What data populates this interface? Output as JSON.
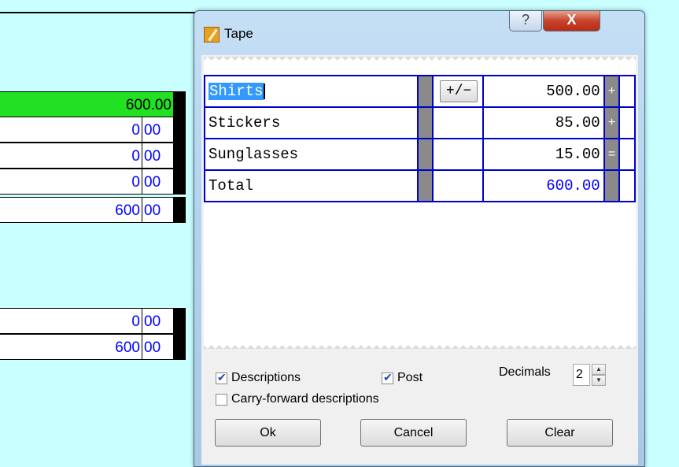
{
  "sheet": {
    "rows": [
      {
        "value": "600.00",
        "highlight": true
      },
      {
        "whole": "0",
        "frac": "00"
      },
      {
        "whole": "0",
        "frac": "00"
      },
      {
        "whole": "0",
        "frac": "00"
      },
      {
        "whole": "600",
        "frac": "00"
      },
      {
        "whole": "0",
        "frac": "00"
      },
      {
        "whole": "600",
        "frac": "00"
      }
    ]
  },
  "dialog": {
    "title": "Tape",
    "help_label": "?",
    "close_label": "X",
    "tape": {
      "rows": [
        {
          "desc": "Shirts",
          "pm": "+/−",
          "amount": "500.00",
          "op": "+"
        },
        {
          "desc": "Stickers",
          "pm": "",
          "amount": "85.00",
          "op": "+"
        },
        {
          "desc": "Sunglasses",
          "pm": "",
          "amount": "15.00",
          "op": "="
        },
        {
          "desc": "Total",
          "pm": "",
          "amount": "600.00",
          "op": ""
        }
      ]
    },
    "options": {
      "descriptions": {
        "label": "Descriptions",
        "checked": true
      },
      "post": {
        "label": "Post",
        "checked": true
      },
      "carry_forward": {
        "label": "Carry-forward descriptions",
        "checked": false
      },
      "decimals_label": "Decimals",
      "decimals_value": "2"
    },
    "buttons": {
      "ok": "Ok",
      "cancel": "Cancel",
      "clear": "Clear"
    }
  },
  "colors": {
    "background": "#c9ffff",
    "highlight": "#22e022",
    "grid": "#0000cc",
    "value_text": "#0000ff"
  }
}
